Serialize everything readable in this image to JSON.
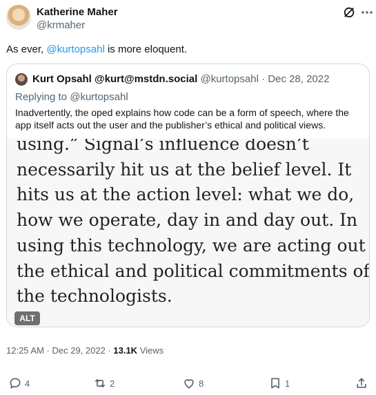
{
  "post": {
    "author_name": "Katherine Maher",
    "author_handle": "@krmaher",
    "text_before": "As ever, ",
    "mention": "@kurtopsahl",
    "text_after": " is more eloquent."
  },
  "quote": {
    "author_name": "Kurt Opsahl @kurt@mstdn.social",
    "handle_date": " @kurtopsahl · Dec 28, 2022",
    "replying_to": "Replying to @kurtopsahl",
    "body": "Inadvertently, the oped explains how code can be a form of speech, where the app itself acts out the user and the publisher’s ethical and political views.",
    "image_text": "using.” Signal’s influence doesn’t\nnecessarily hit us at the belief level. It\nhits us at the action level: what we do,\nhow we operate, day in and day out. In\nusing this technology, we are acting out\nthe ethical and political commitments of\nthe technologists.",
    "alt_badge": "ALT"
  },
  "meta": {
    "timestamp": "12:25 AM · Dec 29, 2022 · ",
    "views_count": "13.1K",
    "views_label": " Views"
  },
  "actions": {
    "replies": "4",
    "reposts": "2",
    "likes": "8",
    "bookmarks": "1"
  },
  "icons": [
    "grok-icon",
    "more-icon",
    "reply-icon",
    "repost-icon",
    "like-icon",
    "bookmark-icon",
    "share-icon"
  ],
  "colors": {
    "link": "#1d9bf0",
    "secondary_text": "#536471",
    "border": "#cfd9de"
  }
}
